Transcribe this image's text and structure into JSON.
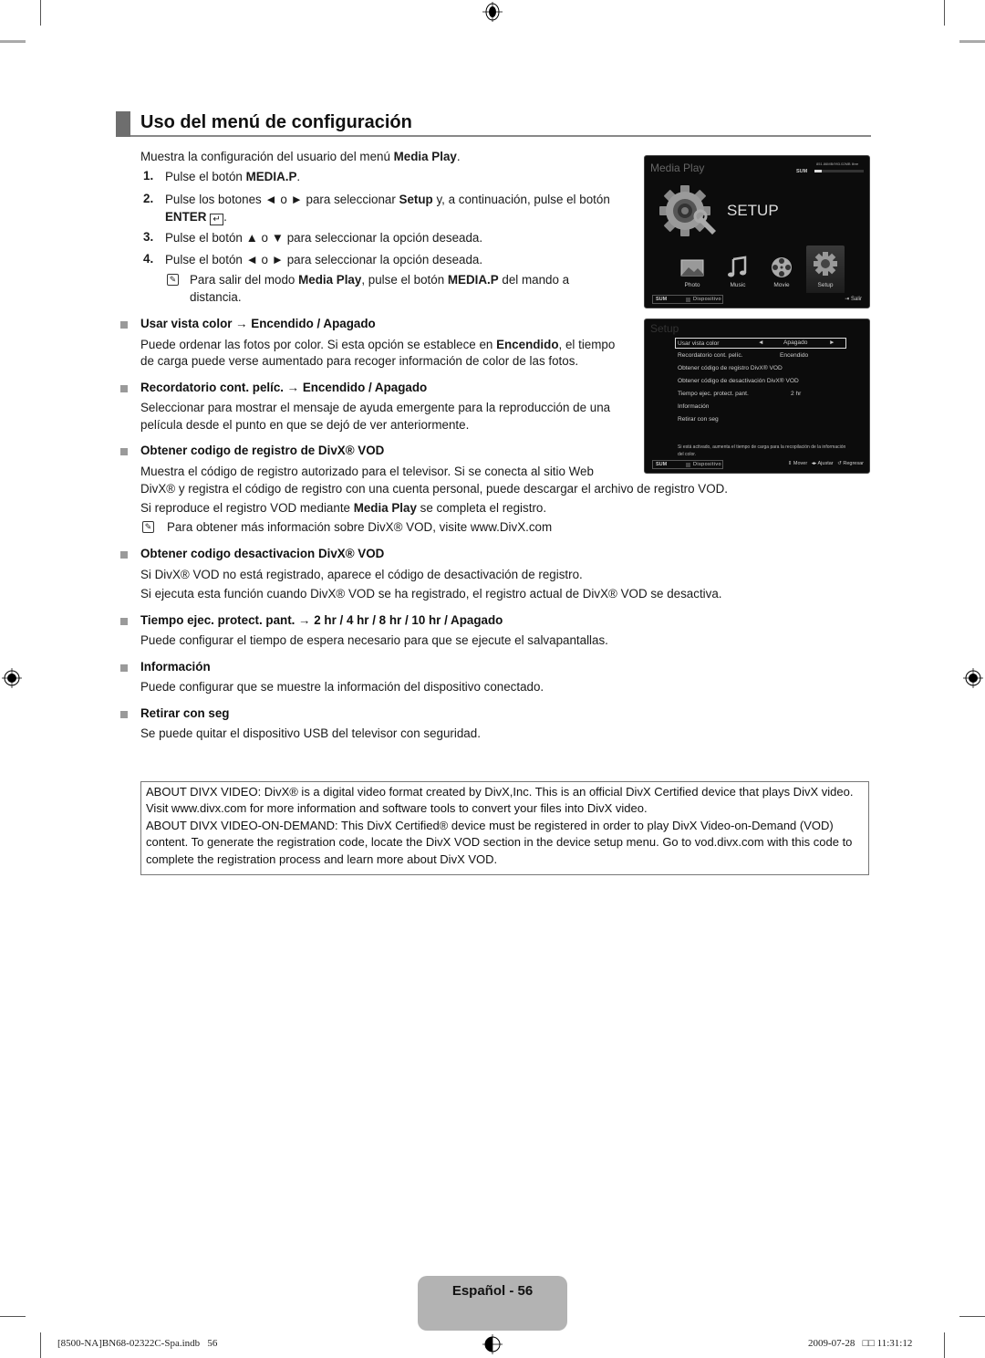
{
  "heading": {
    "title": "Uso del menú de configuración"
  },
  "intro": {
    "pre": "Muestra la configuración del usuario del menú ",
    "bold": "Media Play",
    "post": "."
  },
  "steps": [
    {
      "num": "1.",
      "pre": "Pulse el botón ",
      "bold": "MEDIA.P",
      "post": "."
    },
    {
      "num": "2.",
      "pre": "Pulse los botones ◄ o ► para seleccionar ",
      "bold": "Setup",
      "post": " y, a continuación, pulse el botón",
      "line2": "ENTER"
    },
    {
      "num": "3.",
      "text": "Pulse el botón ▲ o ▼ para seleccionar la opción deseada."
    },
    {
      "num": "4.",
      "text": "Pulse el botón ◄ o ► para seleccionar la opción deseada."
    }
  ],
  "note1": {
    "icon": "note-icon",
    "p1": "Para salir del modo ",
    "b1": "Media Play",
    "p2": ", pulse el botón ",
    "b2": "MEDIA.P",
    "p3": " del mando a",
    "line2": "distancia."
  },
  "sections": [
    {
      "title": "Usar vista color → Encendido / Apagado",
      "l1_pre": "Puede ordenar las fotos por color. Si esta opción se establece en ",
      "l1_bold": "Encendido",
      "l1_post": ", el tiempo",
      "l2": "de carga puede verse aumentado para recoger información de color de las fotos."
    },
    {
      "title": "Recordatorio cont. pelíc. → Encendido / Apagado",
      "l1": "Seleccionar para mostrar el mensaje de ayuda emergente para la reproducción de una",
      "l2": "película desde el punto en que se dejó de ver anteriormente."
    },
    {
      "title": "Obtener codigo de registro de DivX® VOD",
      "l1": "Muestra el código de registro autorizado para el televisor. Si se conecta al sitio Web",
      "l2": "DivX® y registra el código de registro con una cuenta personal, puede descargar el archivo de registro VOD.",
      "l3_pre": "Si reproduce el registro VOD mediante ",
      "l3_bold": "Media Play",
      "l3_post": " se completa el registro.",
      "note": "Para obtener más información sobre DivX® VOD, visite www.DivX.com"
    },
    {
      "title": "Obtener codigo desactivacion DivX® VOD",
      "l1": "Si DivX® VOD no está registrado, aparece el código de desactivación de registro.",
      "l2": "Si ejecuta esta función cuando DivX® VOD se ha registrado, el registro actual de DivX® VOD se desactiva."
    },
    {
      "title": "Tiempo ejec. protect. pant. → 2 hr / 4 hr / 8 hr / 10 hr / Apagado",
      "l1": "Puede configurar el tiempo de espera necesario para que se ejecute el salvapantallas."
    },
    {
      "title": "Información",
      "l1": "Puede configurar que se muestre la información del dispositivo conectado."
    },
    {
      "title": "Retirar con seg",
      "l1": "Se puede quitar el dispositivo USB del televisor con seguridad."
    }
  ],
  "tv1": {
    "title": "Media Play",
    "storage_label": "SUM",
    "storage_text": "851.86MB/993.02MB libre",
    "storage_used_fraction": 0.14,
    "big_label": "SETUP",
    "items": [
      {
        "label": "Photo",
        "icon": "photo-icon"
      },
      {
        "label": "Music",
        "icon": "music-icon"
      },
      {
        "label": "Movie",
        "icon": "movie-icon"
      },
      {
        "label": "Setup",
        "icon": "setup-gear-icon",
        "selected": true
      }
    ],
    "footer": {
      "sum": "SUM",
      "device": "Dispositivo",
      "exit": "Salir"
    }
  },
  "tv2": {
    "title": "Setup",
    "rows": [
      {
        "label": "Usar vista color",
        "value": "Apagado",
        "selected": true
      },
      {
        "label": "Recordatorio cont. pelíc.",
        "value": "Encendido"
      },
      {
        "label": "Obtener código de registro DivX® VOD",
        "value": ""
      },
      {
        "label": "Obtener código de desactivación DivX® VOD",
        "value": ""
      },
      {
        "label": "Tiempo ejec. protect. pant.",
        "value": "2 hr"
      },
      {
        "label": "Información",
        "value": ""
      },
      {
        "label": "Retirar con seg",
        "value": ""
      }
    ],
    "help": "Si está activado, aumenta el tiempo de carga para la recopilación de la información del color.",
    "footer": {
      "sum": "SUM",
      "device": "Dispositivo",
      "move": "Mover",
      "adjust": "Ajustar",
      "back": "Regresar"
    }
  },
  "divx_box": {
    "p1": "ABOUT DIVX VIDEO: DivX® is a digital video format created by DivX,Inc. This is an official DivX Certified device that plays DivX video. Visit www.divx.com for more information and software tools to convert your files into DivX video.",
    "p2": "ABOUT DIVX VIDEO-ON-DEMAND: This DivX Certified® device must be registered in order to play DivX Video-on-Demand (VOD) content. To generate the registration code, locate the DivX VOD section in the device setup menu. Go to vod.divx.com with this code to complete the registration process and learn more about DivX VOD."
  },
  "page_label": "Español - 56",
  "print_footer": {
    "left": "[8500-NA]BN68-02322C-Spa.indb   56",
    "right": "2009-07-28   □□ 11:31:12"
  }
}
